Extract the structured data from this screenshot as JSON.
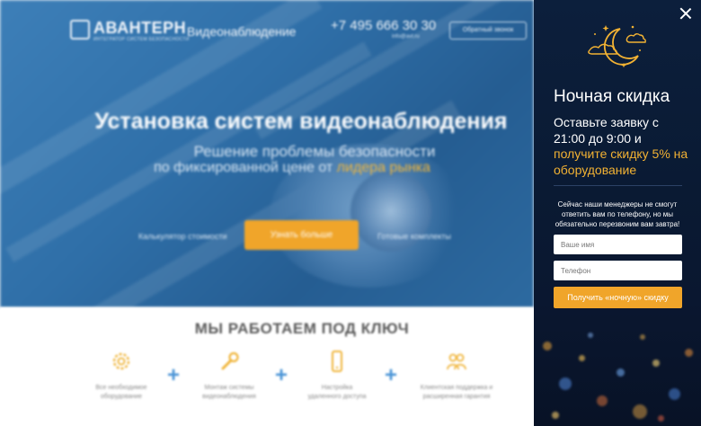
{
  "colors": {
    "hero_blue": "#2f6fa8",
    "accent_orange": "#f0a52a",
    "highlight_yellow": "#f2b233",
    "panel_navy": "#0a1a33",
    "plus_blue": "#4a94d6"
  },
  "header": {
    "logo": "АВАНТЕРН",
    "logo_sub": "ИНТЕГРАТОР СИСТЕМ БЕЗОПАСНОСТИ",
    "nav_title": "Видеонаблюдение",
    "phone": "+7 495 666 30 30",
    "email": "info@avt.ru",
    "callback_button": "Обратный звонок"
  },
  "hero": {
    "title": "Установка систем видеонаблюдения",
    "subtitle_line1": "Решение проблемы безопасности",
    "subtitle_line2_prefix": "по фиксированной цене от ",
    "subtitle_line2_highlight": "лидера рынка",
    "link_calculator": "Калькулятор стоимости",
    "more_button": "Узнать больше",
    "link_ready": "Готовые комплекты"
  },
  "turnkey": {
    "title": "МЫ РАБОТАЕМ ПОД КЛЮЧ",
    "features": [
      {
        "icon": "gear-icon",
        "label_line1": "Все необходимое",
        "label_line2": "оборудование"
      },
      {
        "icon": "wrench-icon",
        "label_line1": "Монтаж системы",
        "label_line2": "видеонаблюдения"
      },
      {
        "icon": "phone-icon",
        "label_line1": "Настройка",
        "label_line2": "удаленного доступа"
      },
      {
        "icon": "people-icon",
        "label_line1": "Клиентская поддержка и",
        "label_line2": "расширенная гарантия"
      }
    ],
    "plus_symbol": "+"
  },
  "panel": {
    "close_icon": "close-icon",
    "moon_icon": "moon-icon",
    "title": "Ночная скидка",
    "lead_part1": "Оставьте заявку с 21:00 до 9:00 и ",
    "lead_part2": "получите скидку 5% на оборудование",
    "note": "Сейчас наши менеджеры не смогут ответить вам по телефону, но мы обязательно перезвоним вам завтра!",
    "name_placeholder": "Ваше имя",
    "phone_placeholder": "Телефон",
    "submit_button": "Получить «ночную» скидку"
  }
}
